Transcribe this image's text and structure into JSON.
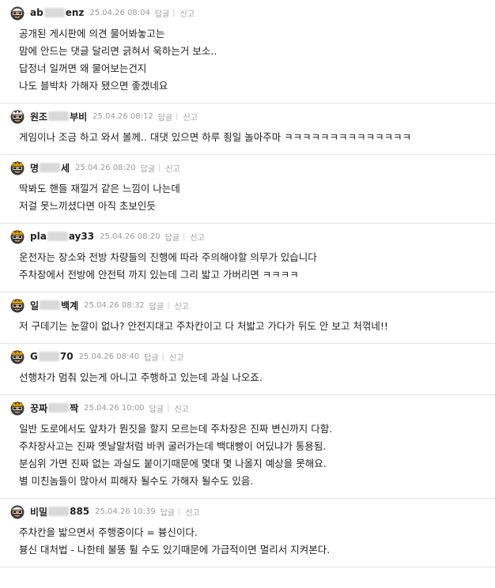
{
  "labels": {
    "reply": "답글",
    "report": "신고",
    "divider": "|"
  },
  "comments": [
    {
      "nick_pre": "ab",
      "nick_post": "enz",
      "date": "25.04.26 08:04",
      "avatar": "white",
      "lines": [
        "공개된 게시판에 의견 물어봐놓고는",
        "맘에 안드는 댓글 달리면 긁혀서 욱하는거 보소..",
        "답정너 일꺼면 왜 물어보는건지",
        "나도 블박차 가해자 됐으면 좋겠네요"
      ]
    },
    {
      "nick_pre": "원조",
      "nick_post": "부비",
      "date": "25.04.26 08:12",
      "avatar": "crown",
      "lines": [
        "게임이나 조금 하고 와서 볼께.. 대댓 있으면 하루 죙일 놀아주마 ㅋㅋㅋㅋㅋㅋㅋㅋㅋㅋㅋㅋㅋㅋ"
      ]
    },
    {
      "nick_pre": "명",
      "nick_post": "세",
      "date": "25.04.26 08:20",
      "avatar": "gold",
      "lines": [
        "딱봐도 핸들 재낄거 같은 느낌이 나는데",
        "저걸 못느끼셨다면 아직 초보인듯"
      ]
    },
    {
      "nick_pre": "pla",
      "nick_post": "ay33",
      "date": "25.04.26 08:20",
      "avatar": "gold",
      "lines": [
        "운전자는 장소와 전방 차량들의 진행에 따라 주의해야할 의무가 있습니다",
        "주차장에서 전방에 안전턱 까지 있는데 그리 밟고 가버리면 ㅋㅋㅋㅋ"
      ]
    },
    {
      "nick_pre": "일",
      "nick_post": "백계",
      "date": "25.04.26 08:32",
      "avatar": "gold",
      "lines": [
        "저 구데기는 눈깔이 없나? 안전지대고 주차칸이고 다 처밟고 가다가 뒤도 안 보고 처꺾네!!"
      ]
    },
    {
      "nick_pre": "G",
      "nick_post": "70",
      "date": "25.04.26 08:40",
      "avatar": "gold",
      "lines": [
        "선행차가 멈춰 있는게 아니고 주행하고 있는데 과실 나오죠."
      ]
    },
    {
      "nick_pre": "꿍짜",
      "nick_post": "짝",
      "date": "25.04.26 10:00",
      "avatar": "gold",
      "lines": [
        "일반 도로에서도 앞차가 뭔짓을 할지 모르는데 주차장은 진짜 변신까지 다함.",
        "주차장사고는 진짜 옛날말처럼 바퀴 굴러가는데 백대빵이 어딨냐가 통용됨.",
        "분심위 가면 진짜 없는 과실도 붙이기때문에 몇대 몇 나올지 예상을 못해요.",
        "별 미친놈들이 많아서 피해자 될수도 가해자 될수도 있음."
      ]
    },
    {
      "nick_pre": "비밀",
      "nick_post": "885",
      "date": "25.04.26 10:39",
      "avatar": "white",
      "lines": [
        "주차칸을 밟으면서 주행중이다 = 븅신이다.",
        "븅신 대처법 - 나한테 불똥 튈 수도 있기때문에 가급적이면 멀리서 지켜본다."
      ]
    }
  ]
}
